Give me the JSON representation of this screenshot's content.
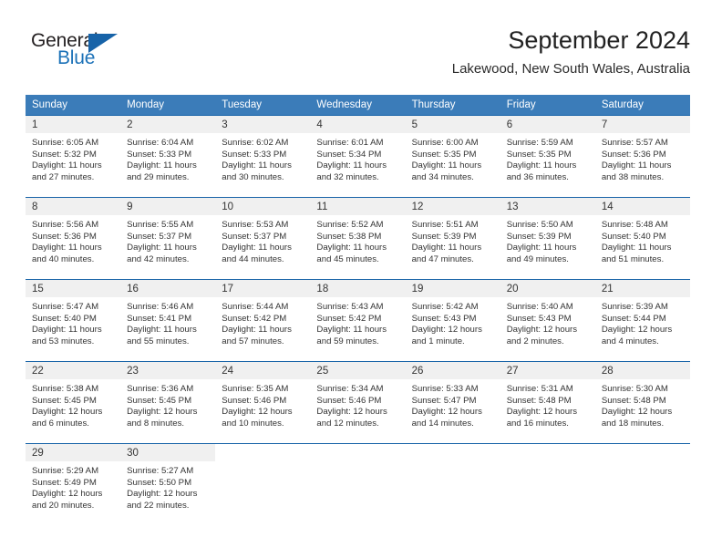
{
  "brand": {
    "name_part1": "General",
    "name_part2": "Blue",
    "triangle_icon": "triangle-logo-icon",
    "accent_color": "#1763a8"
  },
  "header": {
    "month_title": "September 2024",
    "location": "Lakewood, New South Wales, Australia"
  },
  "calendar": {
    "header_bg": "#3b7cb9",
    "row_border": "#1763a8",
    "daynum_bg": "#f0f0f0",
    "weekday_labels": [
      "Sunday",
      "Monday",
      "Tuesday",
      "Wednesday",
      "Thursday",
      "Friday",
      "Saturday"
    ],
    "weeks": [
      [
        {
          "day": "1",
          "sunrise": "Sunrise: 6:05 AM",
          "sunset": "Sunset: 5:32 PM",
          "daylight_l1": "Daylight: 11 hours",
          "daylight_l2": "and 27 minutes."
        },
        {
          "day": "2",
          "sunrise": "Sunrise: 6:04 AM",
          "sunset": "Sunset: 5:33 PM",
          "daylight_l1": "Daylight: 11 hours",
          "daylight_l2": "and 29 minutes."
        },
        {
          "day": "3",
          "sunrise": "Sunrise: 6:02 AM",
          "sunset": "Sunset: 5:33 PM",
          "daylight_l1": "Daylight: 11 hours",
          "daylight_l2": "and 30 minutes."
        },
        {
          "day": "4",
          "sunrise": "Sunrise: 6:01 AM",
          "sunset": "Sunset: 5:34 PM",
          "daylight_l1": "Daylight: 11 hours",
          "daylight_l2": "and 32 minutes."
        },
        {
          "day": "5",
          "sunrise": "Sunrise: 6:00 AM",
          "sunset": "Sunset: 5:35 PM",
          "daylight_l1": "Daylight: 11 hours",
          "daylight_l2": "and 34 minutes."
        },
        {
          "day": "6",
          "sunrise": "Sunrise: 5:59 AM",
          "sunset": "Sunset: 5:35 PM",
          "daylight_l1": "Daylight: 11 hours",
          "daylight_l2": "and 36 minutes."
        },
        {
          "day": "7",
          "sunrise": "Sunrise: 5:57 AM",
          "sunset": "Sunset: 5:36 PM",
          "daylight_l1": "Daylight: 11 hours",
          "daylight_l2": "and 38 minutes."
        }
      ],
      [
        {
          "day": "8",
          "sunrise": "Sunrise: 5:56 AM",
          "sunset": "Sunset: 5:36 PM",
          "daylight_l1": "Daylight: 11 hours",
          "daylight_l2": "and 40 minutes."
        },
        {
          "day": "9",
          "sunrise": "Sunrise: 5:55 AM",
          "sunset": "Sunset: 5:37 PM",
          "daylight_l1": "Daylight: 11 hours",
          "daylight_l2": "and 42 minutes."
        },
        {
          "day": "10",
          "sunrise": "Sunrise: 5:53 AM",
          "sunset": "Sunset: 5:37 PM",
          "daylight_l1": "Daylight: 11 hours",
          "daylight_l2": "and 44 minutes."
        },
        {
          "day": "11",
          "sunrise": "Sunrise: 5:52 AM",
          "sunset": "Sunset: 5:38 PM",
          "daylight_l1": "Daylight: 11 hours",
          "daylight_l2": "and 45 minutes."
        },
        {
          "day": "12",
          "sunrise": "Sunrise: 5:51 AM",
          "sunset": "Sunset: 5:39 PM",
          "daylight_l1": "Daylight: 11 hours",
          "daylight_l2": "and 47 minutes."
        },
        {
          "day": "13",
          "sunrise": "Sunrise: 5:50 AM",
          "sunset": "Sunset: 5:39 PM",
          "daylight_l1": "Daylight: 11 hours",
          "daylight_l2": "and 49 minutes."
        },
        {
          "day": "14",
          "sunrise": "Sunrise: 5:48 AM",
          "sunset": "Sunset: 5:40 PM",
          "daylight_l1": "Daylight: 11 hours",
          "daylight_l2": "and 51 minutes."
        }
      ],
      [
        {
          "day": "15",
          "sunrise": "Sunrise: 5:47 AM",
          "sunset": "Sunset: 5:40 PM",
          "daylight_l1": "Daylight: 11 hours",
          "daylight_l2": "and 53 minutes."
        },
        {
          "day": "16",
          "sunrise": "Sunrise: 5:46 AM",
          "sunset": "Sunset: 5:41 PM",
          "daylight_l1": "Daylight: 11 hours",
          "daylight_l2": "and 55 minutes."
        },
        {
          "day": "17",
          "sunrise": "Sunrise: 5:44 AM",
          "sunset": "Sunset: 5:42 PM",
          "daylight_l1": "Daylight: 11 hours",
          "daylight_l2": "and 57 minutes."
        },
        {
          "day": "18",
          "sunrise": "Sunrise: 5:43 AM",
          "sunset": "Sunset: 5:42 PM",
          "daylight_l1": "Daylight: 11 hours",
          "daylight_l2": "and 59 minutes."
        },
        {
          "day": "19",
          "sunrise": "Sunrise: 5:42 AM",
          "sunset": "Sunset: 5:43 PM",
          "daylight_l1": "Daylight: 12 hours",
          "daylight_l2": "and 1 minute."
        },
        {
          "day": "20",
          "sunrise": "Sunrise: 5:40 AM",
          "sunset": "Sunset: 5:43 PM",
          "daylight_l1": "Daylight: 12 hours",
          "daylight_l2": "and 2 minutes."
        },
        {
          "day": "21",
          "sunrise": "Sunrise: 5:39 AM",
          "sunset": "Sunset: 5:44 PM",
          "daylight_l1": "Daylight: 12 hours",
          "daylight_l2": "and 4 minutes."
        }
      ],
      [
        {
          "day": "22",
          "sunrise": "Sunrise: 5:38 AM",
          "sunset": "Sunset: 5:45 PM",
          "daylight_l1": "Daylight: 12 hours",
          "daylight_l2": "and 6 minutes."
        },
        {
          "day": "23",
          "sunrise": "Sunrise: 5:36 AM",
          "sunset": "Sunset: 5:45 PM",
          "daylight_l1": "Daylight: 12 hours",
          "daylight_l2": "and 8 minutes."
        },
        {
          "day": "24",
          "sunrise": "Sunrise: 5:35 AM",
          "sunset": "Sunset: 5:46 PM",
          "daylight_l1": "Daylight: 12 hours",
          "daylight_l2": "and 10 minutes."
        },
        {
          "day": "25",
          "sunrise": "Sunrise: 5:34 AM",
          "sunset": "Sunset: 5:46 PM",
          "daylight_l1": "Daylight: 12 hours",
          "daylight_l2": "and 12 minutes."
        },
        {
          "day": "26",
          "sunrise": "Sunrise: 5:33 AM",
          "sunset": "Sunset: 5:47 PM",
          "daylight_l1": "Daylight: 12 hours",
          "daylight_l2": "and 14 minutes."
        },
        {
          "day": "27",
          "sunrise": "Sunrise: 5:31 AM",
          "sunset": "Sunset: 5:48 PM",
          "daylight_l1": "Daylight: 12 hours",
          "daylight_l2": "and 16 minutes."
        },
        {
          "day": "28",
          "sunrise": "Sunrise: 5:30 AM",
          "sunset": "Sunset: 5:48 PM",
          "daylight_l1": "Daylight: 12 hours",
          "daylight_l2": "and 18 minutes."
        }
      ],
      [
        {
          "day": "29",
          "sunrise": "Sunrise: 5:29 AM",
          "sunset": "Sunset: 5:49 PM",
          "daylight_l1": "Daylight: 12 hours",
          "daylight_l2": "and 20 minutes."
        },
        {
          "day": "30",
          "sunrise": "Sunrise: 5:27 AM",
          "sunset": "Sunset: 5:50 PM",
          "daylight_l1": "Daylight: 12 hours",
          "daylight_l2": "and 22 minutes."
        },
        {
          "day": "",
          "sunrise": "",
          "sunset": "",
          "daylight_l1": "",
          "daylight_l2": ""
        },
        {
          "day": "",
          "sunrise": "",
          "sunset": "",
          "daylight_l1": "",
          "daylight_l2": ""
        },
        {
          "day": "",
          "sunrise": "",
          "sunset": "",
          "daylight_l1": "",
          "daylight_l2": ""
        },
        {
          "day": "",
          "sunrise": "",
          "sunset": "",
          "daylight_l1": "",
          "daylight_l2": ""
        },
        {
          "day": "",
          "sunrise": "",
          "sunset": "",
          "daylight_l1": "",
          "daylight_l2": ""
        }
      ]
    ]
  }
}
